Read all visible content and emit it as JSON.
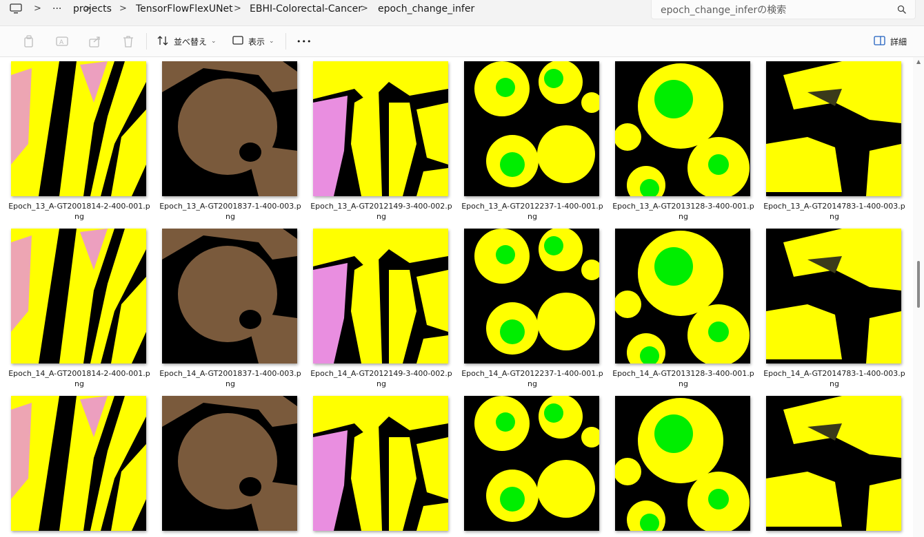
{
  "address": {
    "items": [
      "projects",
      "TensorFlowFlexUNet",
      "EBHI-Colorectal-Cancer",
      "epoch_change_infer"
    ],
    "separator": ">",
    "ellipsis": "···",
    "icons": [
      "monitor-icon",
      "chevron-right-icon"
    ]
  },
  "search": {
    "placeholder": "epoch_change_inferの検索",
    "icon": "search-icon"
  },
  "toolbar": {
    "icons": [
      "copy-icon",
      "rename-icon",
      "share-icon",
      "delete-icon"
    ],
    "sort_label": "並べ替え",
    "view_label": "表示",
    "more_label": "•••",
    "details_label": "詳細"
  },
  "colors": {
    "yellow": "#ffff00",
    "pink": "#e98ee0",
    "brown": "#7a5a3c",
    "green": "#00ee00",
    "black": "#000000"
  },
  "files": [
    {
      "name": "Epoch_13_A-GT2001814-2-400-001.png",
      "kind": "stripes"
    },
    {
      "name": "Epoch_13_A-GT2001837-1-400-003.png",
      "kind": "brown"
    },
    {
      "name": "Epoch_13_A-GT2012149-3-400-002.png",
      "kind": "bands"
    },
    {
      "name": "Epoch_13_A-GT2012237-1-400-001.png",
      "kind": "circles"
    },
    {
      "name": "Epoch_13_A-GT2013128-3-400-001.png",
      "kind": "bigcircle"
    },
    {
      "name": "Epoch_13_A-GT2014783-1-400-003.png",
      "kind": "blobs"
    },
    {
      "name": "Epoch_14_A-GT2001814-2-400-001.png",
      "kind": "stripes"
    },
    {
      "name": "Epoch_14_A-GT2001837-1-400-003.png",
      "kind": "brown"
    },
    {
      "name": "Epoch_14_A-GT2012149-3-400-002.png",
      "kind": "bands"
    },
    {
      "name": "Epoch_14_A-GT2012237-1-400-001.png",
      "kind": "circles"
    },
    {
      "name": "Epoch_14_A-GT2013128-3-400-001.png",
      "kind": "bigcircle"
    },
    {
      "name": "Epoch_14_A-GT2014783-1-400-003.png",
      "kind": "blobs"
    },
    {
      "name": "",
      "kind": "stripes"
    },
    {
      "name": "",
      "kind": "brown"
    },
    {
      "name": "",
      "kind": "bands"
    },
    {
      "name": "",
      "kind": "circles"
    },
    {
      "name": "",
      "kind": "bigcircle"
    },
    {
      "name": "",
      "kind": "blobs"
    }
  ]
}
